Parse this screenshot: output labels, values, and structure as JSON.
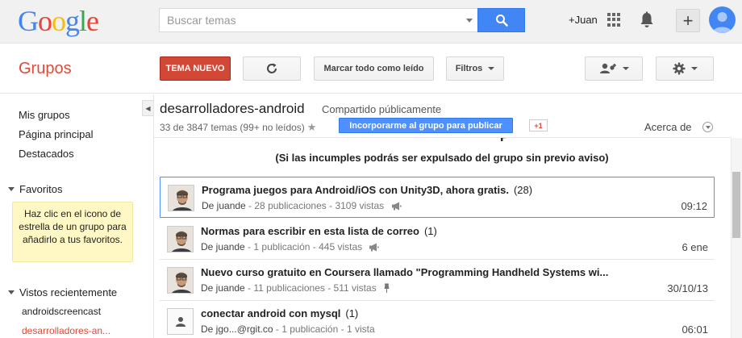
{
  "header": {
    "logo_letters": [
      {
        "ch": "G",
        "color": "#4285f4"
      },
      {
        "ch": "o",
        "color": "#ea4335"
      },
      {
        "ch": "o",
        "color": "#fbbc05"
      },
      {
        "ch": "g",
        "color": "#4285f4"
      },
      {
        "ch": "l",
        "color": "#34a853"
      },
      {
        "ch": "e",
        "color": "#ea4335"
      }
    ],
    "search_placeholder": "Buscar temas",
    "user_link": "+Juan",
    "plus_label": "+"
  },
  "toolbar": {
    "app_title": "Grupos",
    "new_topic": "TEMA NUEVO",
    "mark_all_read": "Marcar todo como leído",
    "filters": "Filtros"
  },
  "sidebar": {
    "links": [
      "Mis grupos",
      "Página principal",
      "Destacados"
    ],
    "favorites_title": "Favoritos",
    "favorites_hint": "Haz clic en el icono de estrella de un grupo para añadirlo a tus favoritos.",
    "recent_title": "Vistos recientemente",
    "recent": [
      "androidscreencast",
      "desarrolladores-an..."
    ]
  },
  "group": {
    "name": "desarrolladores-android",
    "visibility": "Compartido públicamente",
    "topic_count": "33 de 3847 temas (99+ no leídos)",
    "join_label": "Incorporarme al grupo para publicar",
    "gplus": "+1",
    "about": "Acerca de"
  },
  "banner": {
    "partial_title": "P",
    "warning": "(Si las incumples podrás ser expulsado del grupo sin previo aviso)"
  },
  "threads": [
    {
      "title": "Programa juegos para Android/iOS con Unity3D, ahora gratis.",
      "count": "(28)",
      "author": "De juande",
      "meta": " - 28 publicaciones - 3109 vistas",
      "icon": "megaphone",
      "date": "09:12"
    },
    {
      "title": "Normas para escribir en esta lista de correo",
      "count": "(1)",
      "author": "De juande",
      "meta": " - 1 publicación - 445 vistas",
      "icon": "megaphone",
      "date": "6 ene"
    },
    {
      "title": "Nuevo curso gratuito en Coursera llamado \"Programming Handheld Systems wi...",
      "count": "",
      "author": "De juande",
      "meta": " - 11 publicaciones - 511 vistas",
      "icon": "pin",
      "date": "30/10/13"
    },
    {
      "title": "conectar android con mysql",
      "count": "(1)",
      "author": "De jgo...@rgit.co",
      "meta": " - 1 publicación - 1 vista",
      "icon": "",
      "date": "06:01"
    }
  ]
}
